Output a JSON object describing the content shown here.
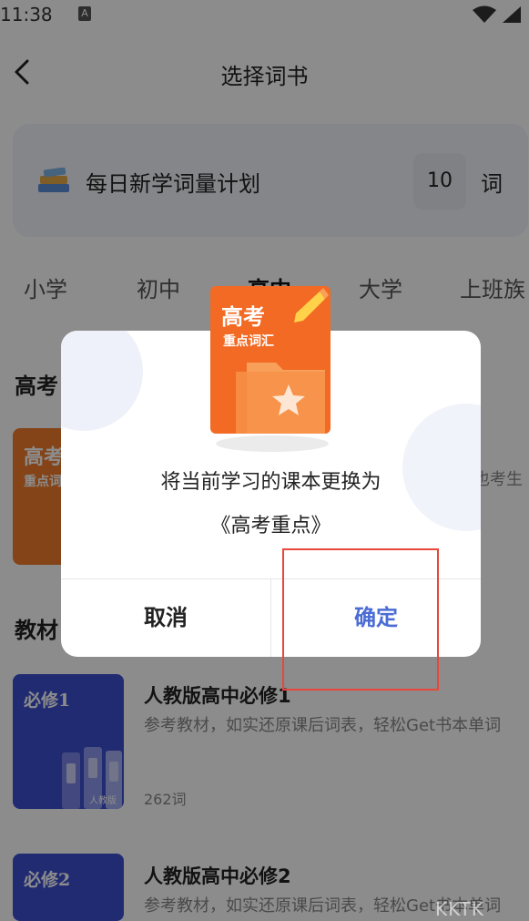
{
  "status_bar": {
    "time": "11:38",
    "badge": "A"
  },
  "header": {
    "title": "选择词书"
  },
  "plan": {
    "label": "每日新学词量计划",
    "value": "10",
    "unit": "词"
  },
  "tabs": [
    {
      "label": "小学"
    },
    {
      "label": "初中"
    },
    {
      "label": "高中"
    },
    {
      "label": "大学"
    },
    {
      "label": "上班族"
    }
  ],
  "section1": {
    "title": "高考",
    "cover_title": "高考",
    "cover_sub": "重点词",
    "desc_partial": "也考生"
  },
  "section2": {
    "title": "教材",
    "books": [
      {
        "cover_label": "必修1",
        "publisher": "人教版",
        "title": "人教版高中必修1",
        "desc": "参考教材，如实还原课后词表，轻松Get书本单词",
        "count": "262词"
      },
      {
        "cover_label": "必修2",
        "title": "人教版高中必修2",
        "desc": "参考教材，如实还原课后词表，轻松Get书本单词"
      }
    ]
  },
  "dialog": {
    "book_cover_title": "高考",
    "book_cover_sub": "重点词汇",
    "message": "将当前学习的课本更换为",
    "book_name": "《高考重点》",
    "cancel_label": "取消",
    "confirm_label": "确定"
  },
  "watermark": "KKTK"
}
